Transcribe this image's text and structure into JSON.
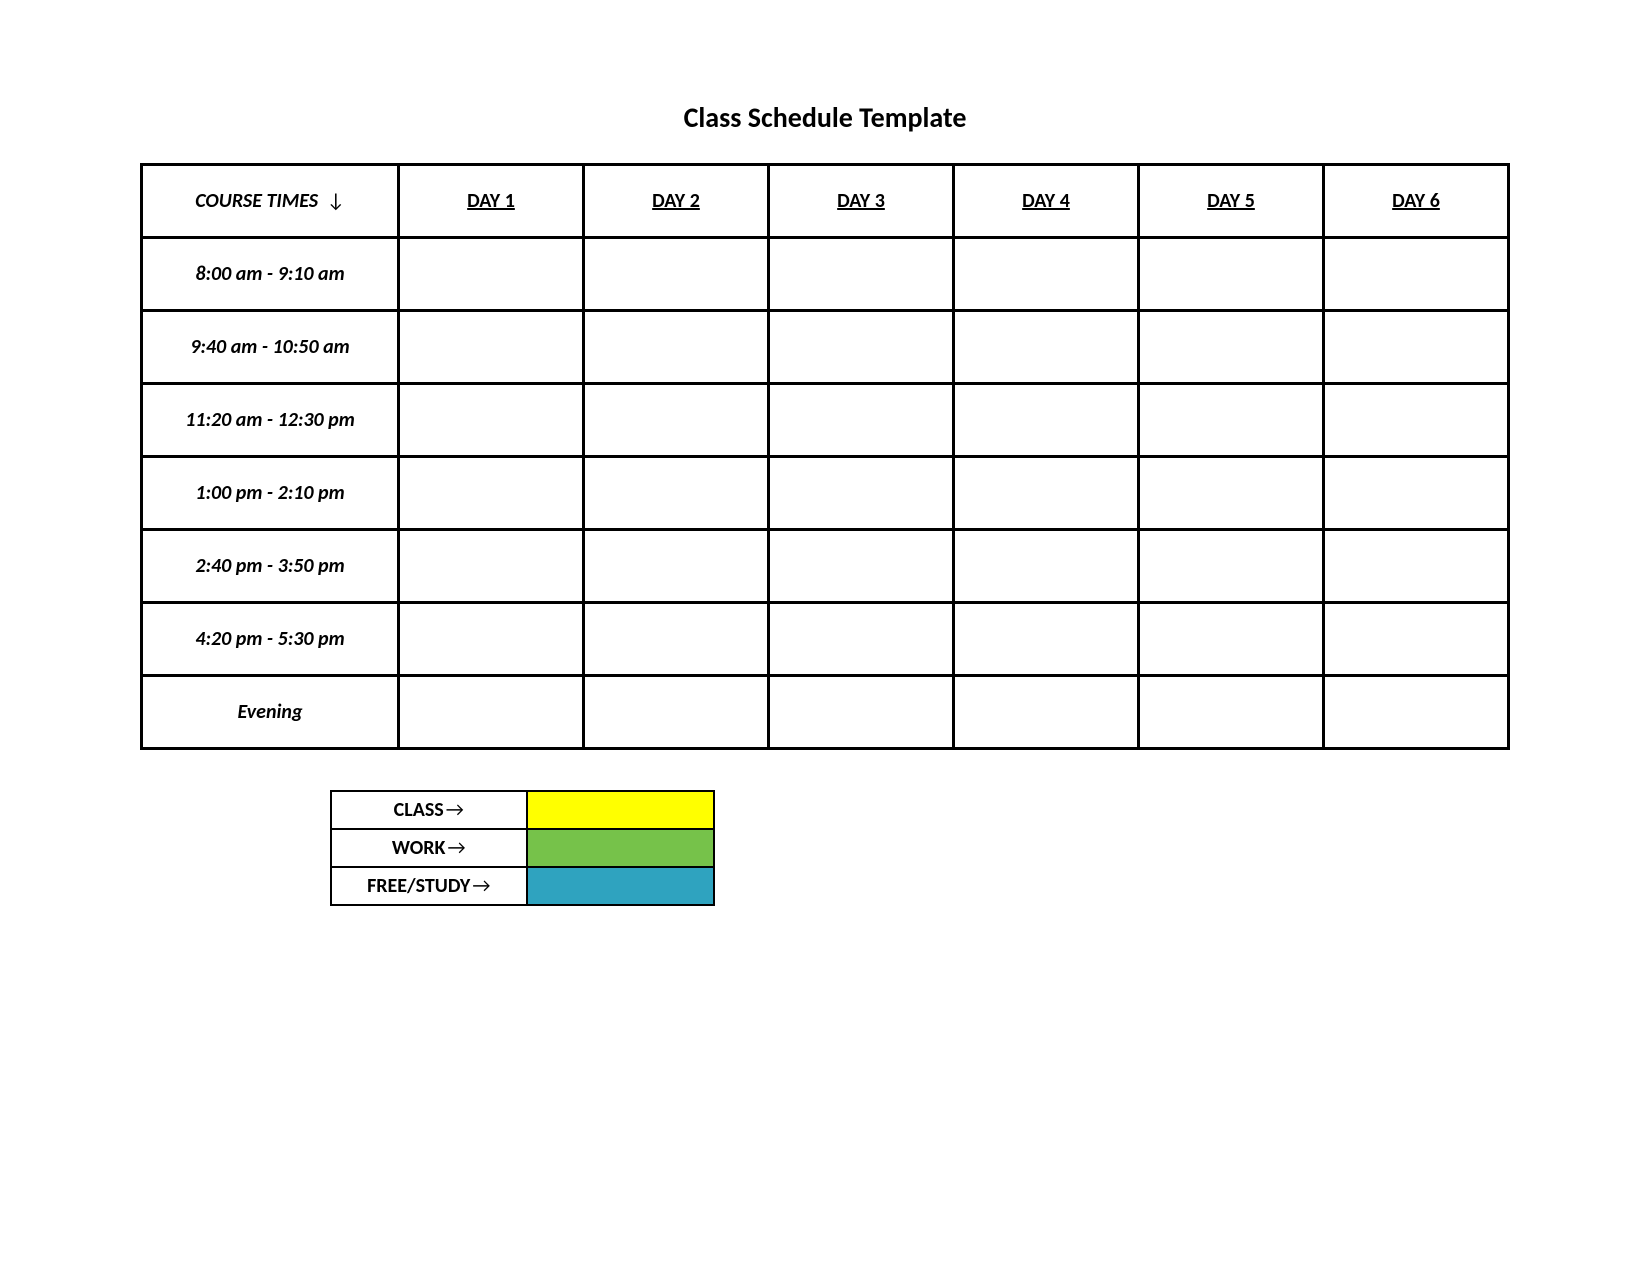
{
  "title": "Class Schedule Template",
  "arrows": {
    "down": "↓",
    "right": "→"
  },
  "table": {
    "times_header": "COURSE TIMES",
    "days": [
      "DAY 1",
      "DAY 2",
      "DAY 3",
      "DAY 4",
      "DAY 5",
      "DAY 6"
    ],
    "time_rows": [
      "8:00 am - 9:10 am",
      "9:40 am - 10:50 am",
      "11:20 am - 12:30 pm",
      "1:00 pm - 2:10 pm",
      "2:40 pm - 3:50 pm",
      "4:20 pm - 5:30 pm",
      "Evening"
    ]
  },
  "legend": {
    "items": [
      {
        "label": "CLASS",
        "color": "#ffff00"
      },
      {
        "label": "WORK",
        "color": "#76c24a"
      },
      {
        "label": "FREE/STUDY",
        "color": "#2fa3bf"
      }
    ]
  }
}
